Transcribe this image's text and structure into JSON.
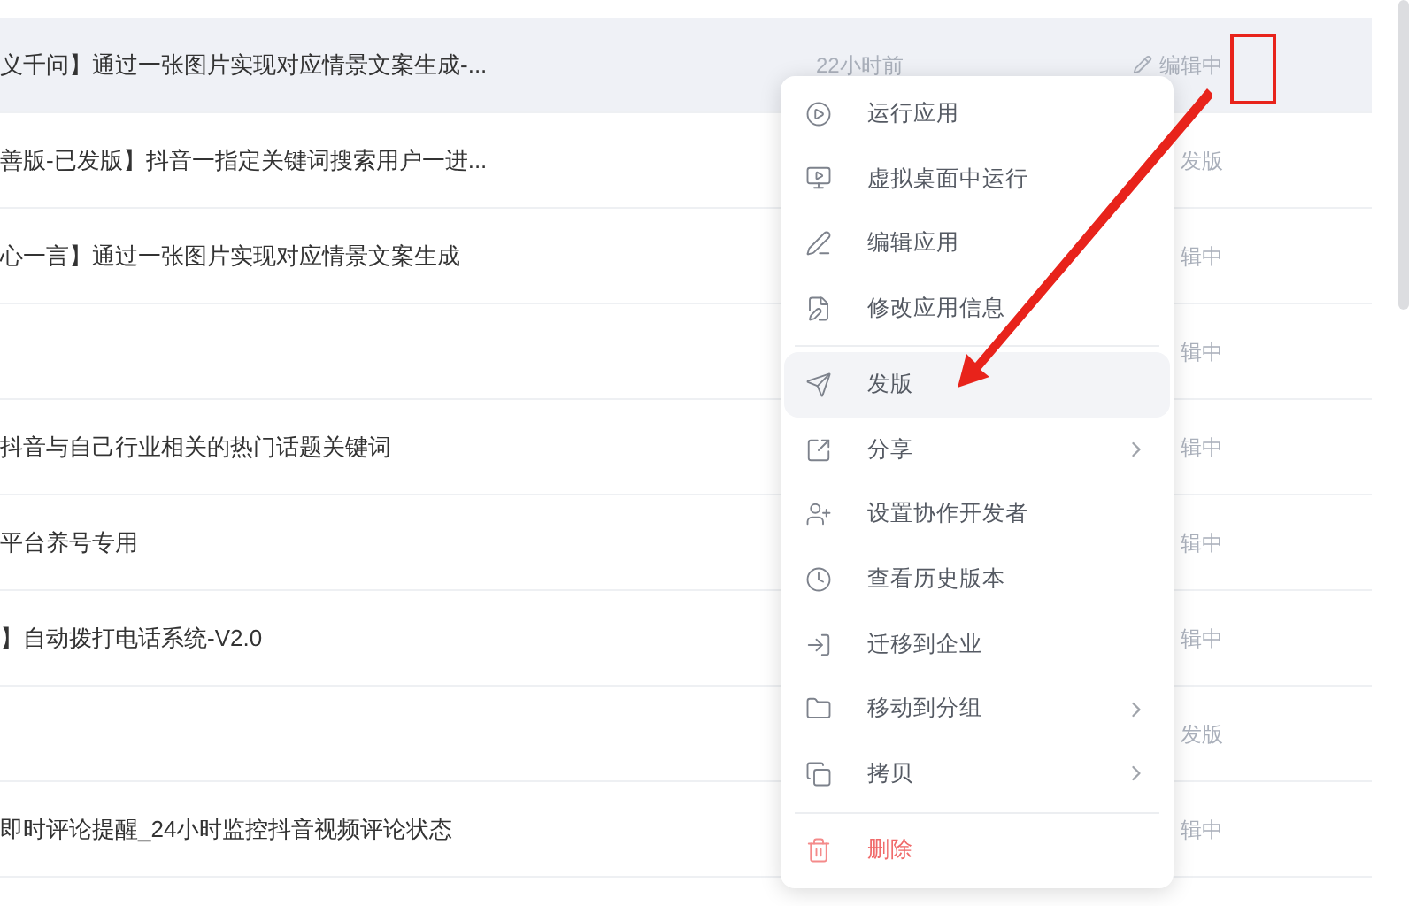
{
  "rows": [
    {
      "title": "义千问】通过一张图片实现对应情景文案生成-...",
      "time": "22小时前",
      "status": "编辑中",
      "status_icon": true,
      "selected": true
    },
    {
      "title": "善版-已发版】抖音一指定关键词搜索用户一进...",
      "status": "发版",
      "selected": false
    },
    {
      "title": "心一言】通过一张图片实现对应情景文案生成",
      "status": "辑中",
      "selected": false
    },
    {
      "status": "辑中",
      "selected": false
    },
    {
      "title": "抖音与自己行业相关的热门话题关键词",
      "status": "辑中",
      "selected": false
    },
    {
      "title": "平台养号专用",
      "status": "辑中",
      "selected": false
    },
    {
      "title": "】自动拨打电话系统-V2.0",
      "status": "辑中",
      "selected": false
    },
    {
      "status": "发版",
      "selected": false
    },
    {
      "title": "即时评论提醒_24小时监控抖音视频评论状态",
      "status": "辑中",
      "selected": false
    }
  ],
  "menu": {
    "items": [
      {
        "kind": "item",
        "label": "运行应用",
        "selected": false
      },
      {
        "kind": "item",
        "label": "虚拟桌面中运行",
        "selected": false
      },
      {
        "kind": "item",
        "label": "编辑应用",
        "selected": false
      },
      {
        "kind": "item",
        "label": "修改应用信息",
        "selected": false
      },
      {
        "kind": "divider"
      },
      {
        "kind": "item",
        "label": "发版",
        "selected": true
      },
      {
        "kind": "item",
        "label": "分享",
        "submenu": true,
        "selected": false
      },
      {
        "kind": "item",
        "label": "设置协作开发者",
        "selected": false
      },
      {
        "kind": "item",
        "label": "查看历史版本",
        "selected": false
      },
      {
        "kind": "item",
        "label": "迁移到企业",
        "selected": false
      },
      {
        "kind": "item",
        "label": "移动到分组",
        "submenu": true,
        "selected": false
      },
      {
        "kind": "item",
        "label": "拷贝",
        "submenu": true,
        "selected": false
      },
      {
        "kind": "divider"
      },
      {
        "kind": "danger",
        "label": "删除",
        "selected": false
      }
    ]
  }
}
